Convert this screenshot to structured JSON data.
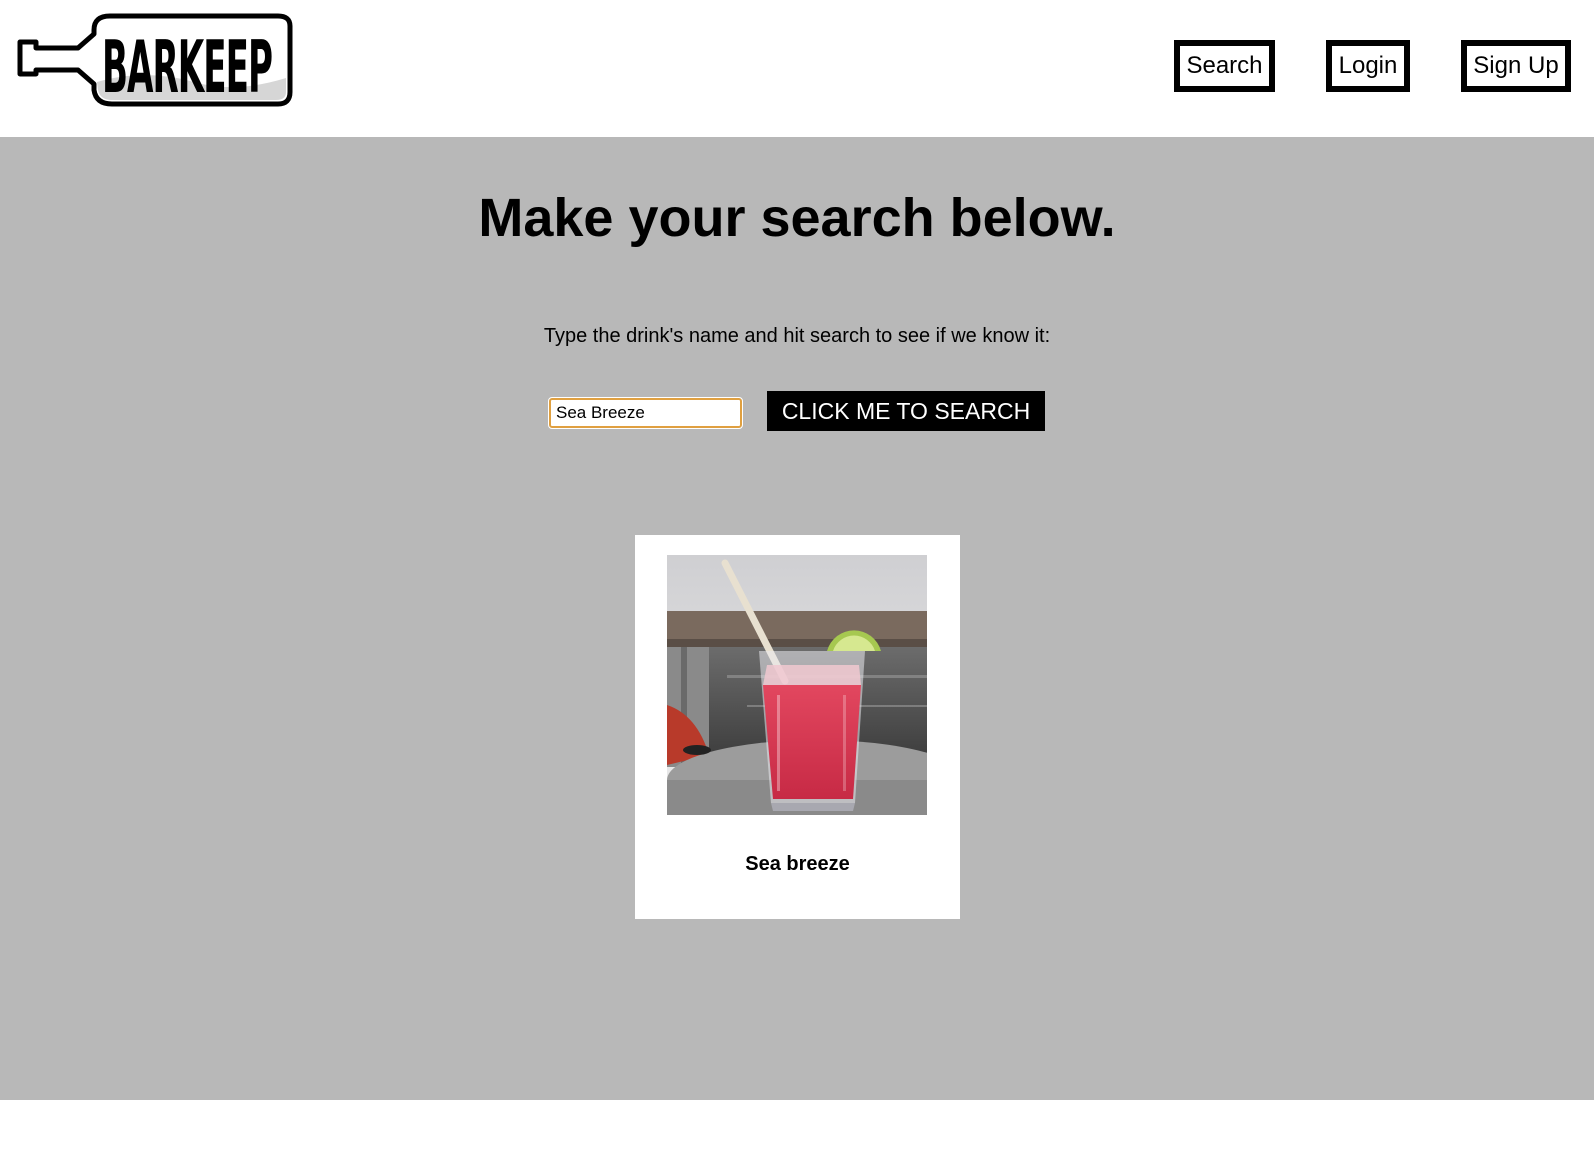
{
  "header": {
    "logo_text": "BARKEEP",
    "nav": {
      "search_label": "Search",
      "login_label": "Login",
      "signup_label": "Sign Up"
    }
  },
  "main": {
    "title": "Make your search below.",
    "instructions": "Type the drink's name and hit search to see if we know it:",
    "search_input_value": "Sea Breeze",
    "search_button_label": "CLICK ME TO SEARCH"
  },
  "results": [
    {
      "name": "Sea breeze"
    }
  ],
  "colors": {
    "main_background": "#b8b8b8",
    "input_focus_border": "#e0a040",
    "button_background": "#000000",
    "drink_color": "#d8344e"
  }
}
